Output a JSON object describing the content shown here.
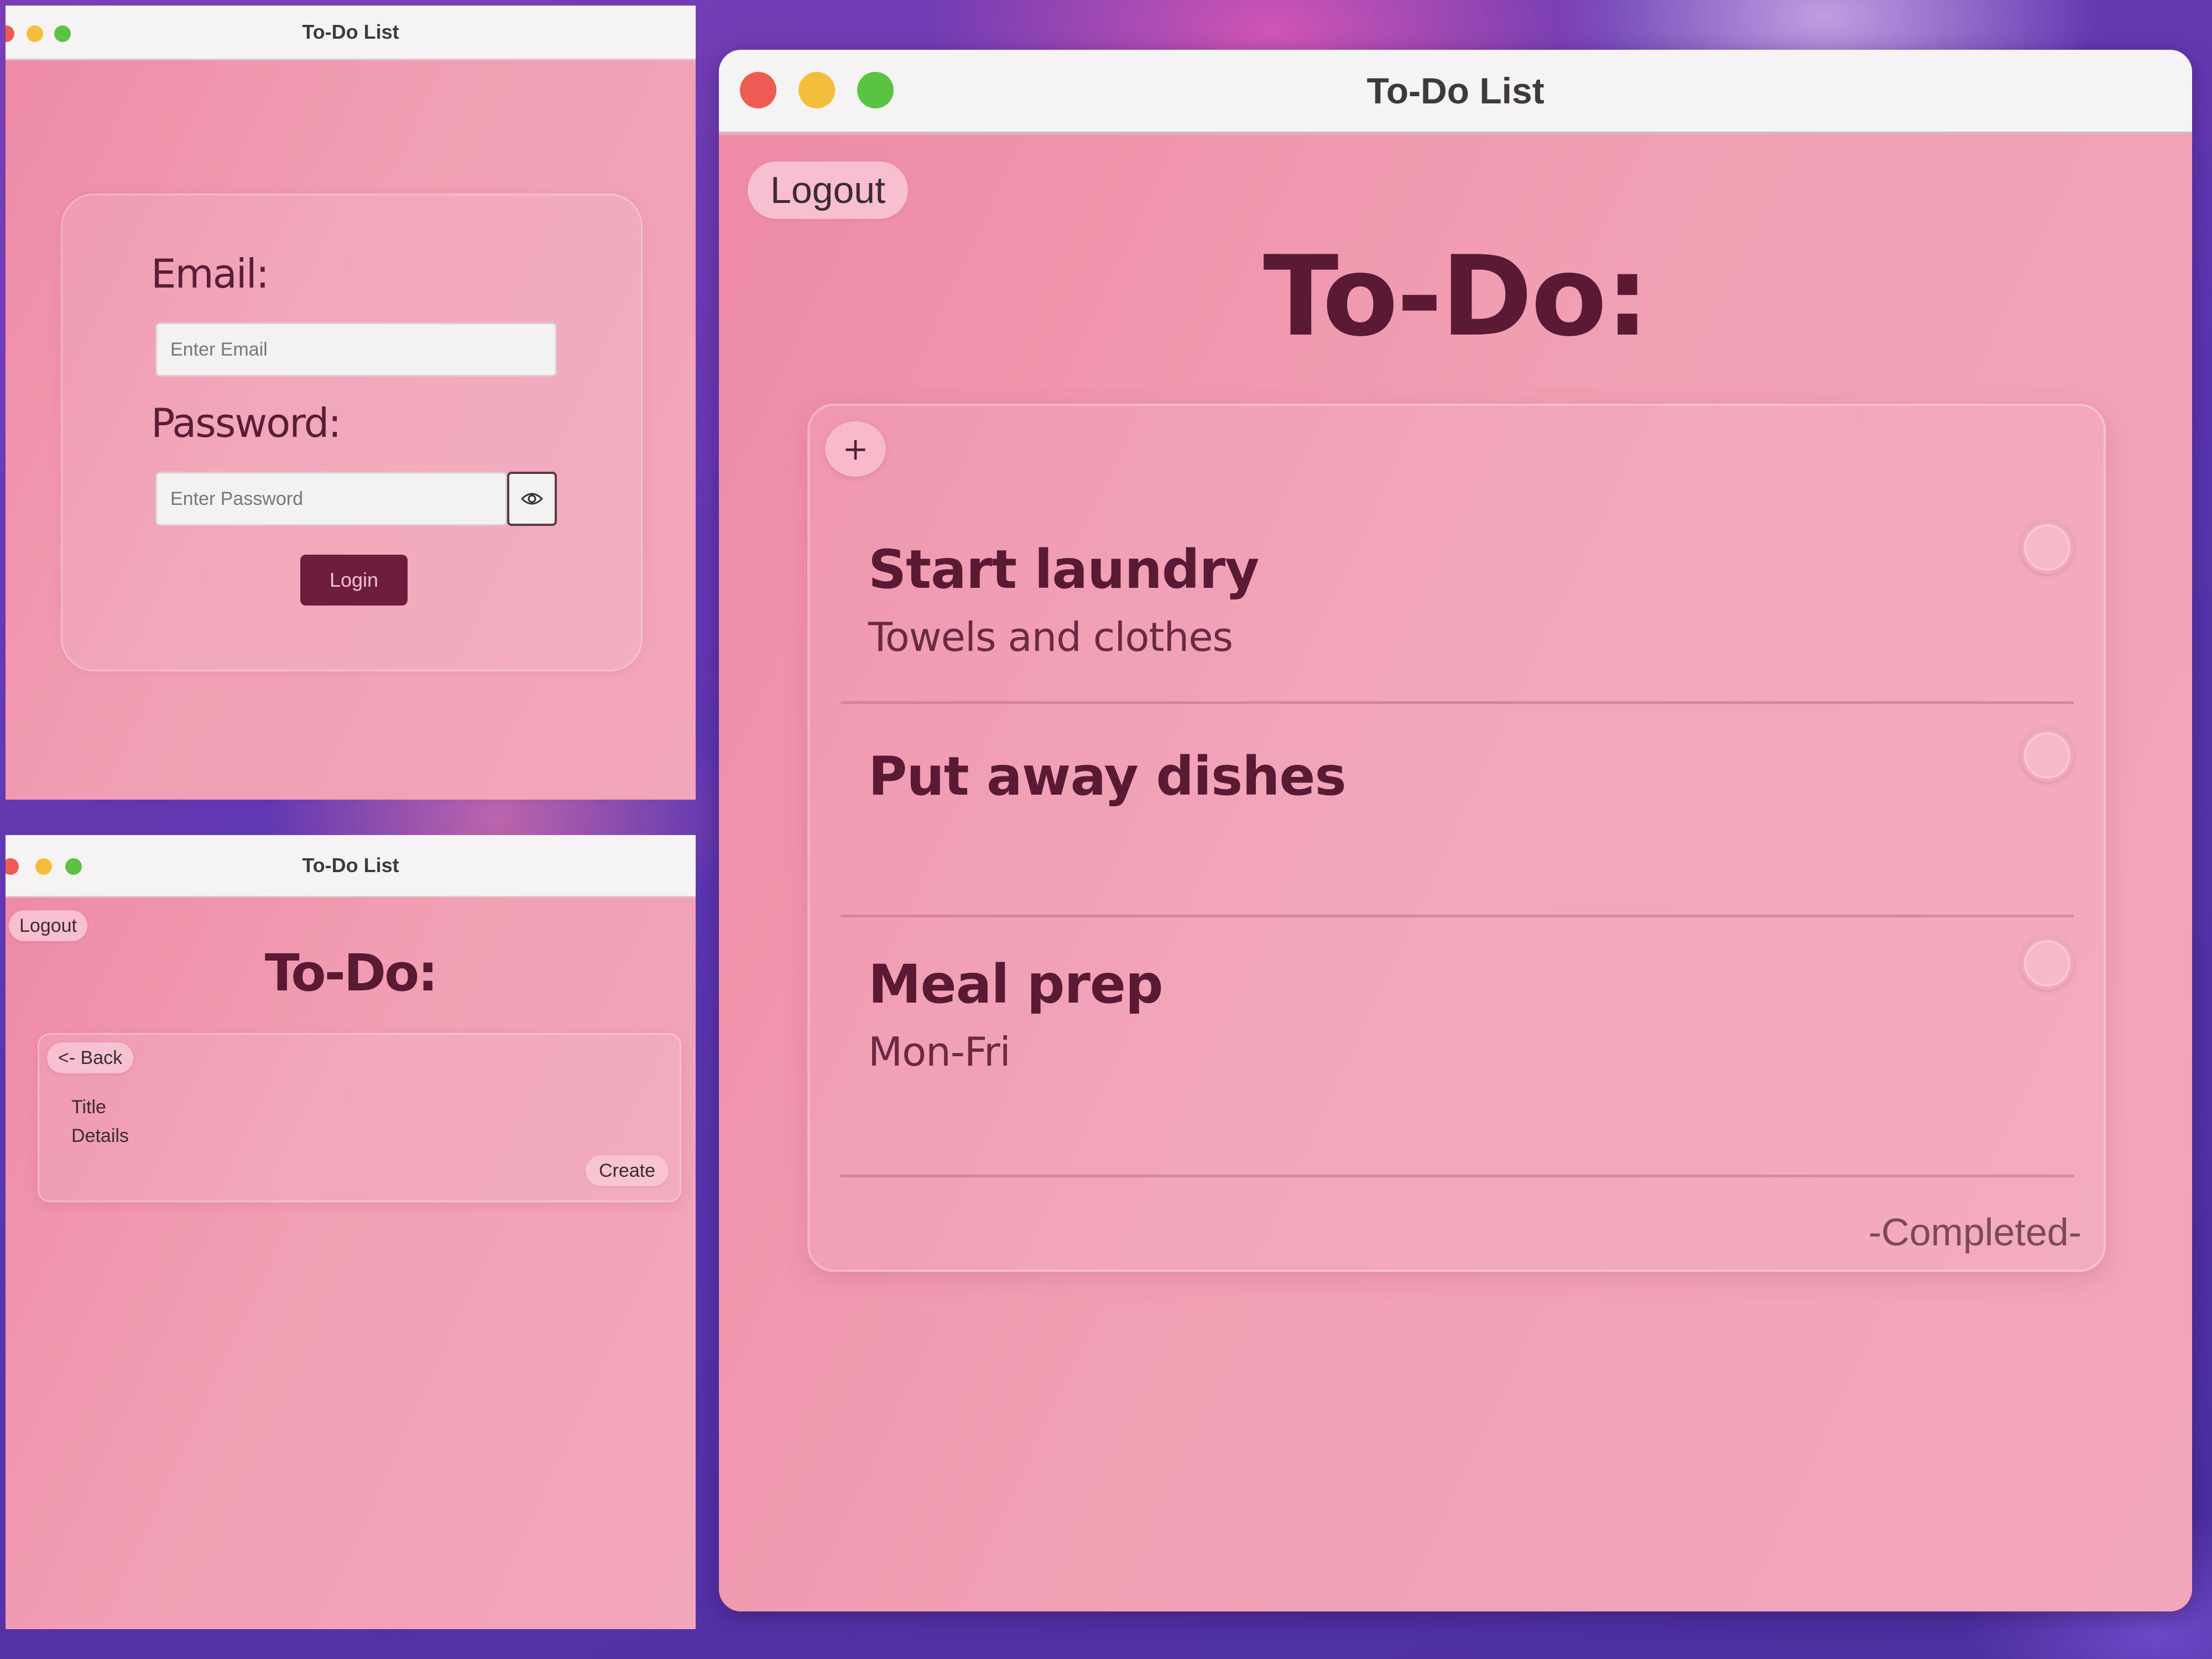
{
  "app_title": "To-Do List",
  "login": {
    "email_label": "Email:",
    "email_placeholder": "Enter Email",
    "password_label": "Password:",
    "password_placeholder": "Enter Password",
    "login_button": "Login"
  },
  "create": {
    "logout_button": "Logout",
    "heading": "To-Do:",
    "back_button": "<- Back",
    "title_label": "Title",
    "details_label": "Details",
    "create_button": "Create"
  },
  "list": {
    "logout_button": "Logout",
    "heading": "To-Do:",
    "add_button": "+",
    "tasks": [
      {
        "title": "Start laundry",
        "details": "Towels and clothes"
      },
      {
        "title": "Put away dishes",
        "details": ""
      },
      {
        "title": "Meal prep",
        "details": "Mon-Fri"
      }
    ],
    "completed_label": "-Completed-"
  },
  "colors": {
    "window_bg": "#f19fb4",
    "accent": "#6e1e3c",
    "heading_text": "#5a1a33"
  }
}
